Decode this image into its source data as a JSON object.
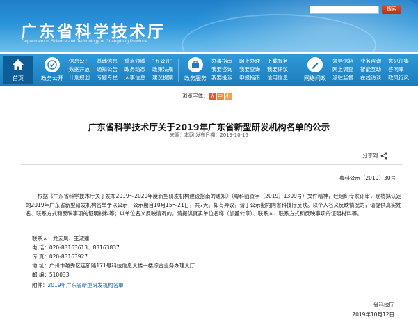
{
  "header": {
    "title": "广东省科学技术厅",
    "subtitle": "Department of Science and Technology of Guangdong Province",
    "search_button": "搜索",
    "search_placeholder": ""
  },
  "nav": {
    "home": "首页",
    "gov_public": {
      "label": "政务公开",
      "col1": [
        "信息公开",
        "数据开放",
        "计划规划"
      ],
      "col2": [
        "基础信息",
        "通知公告",
        "专题专栏"
      ],
      "col3": [
        "重点领域",
        "政务动态",
        "人事信息"
      ],
      "col4": [
        "\"五公开\"",
        "政策法规",
        "建议提案"
      ]
    },
    "gov_service": {
      "label": "政务服务",
      "col1": [
        "办事指南",
        "我要咨询",
        "我要投诉"
      ],
      "col2": [
        "网上办理",
        "我要查询",
        "申报指南"
      ],
      "col3": [
        "下载服务",
        "我要评议",
        "信用信息"
      ]
    },
    "interaction": {
      "label": "网络问政",
      "col1": [
        "领导信箱",
        "网上调查",
        "派驻监督"
      ],
      "col2": [
        "业务咨询",
        "智能互动",
        "在线访谈"
      ],
      "col3": [
        "意见征集",
        "答问库",
        "政风行风"
      ]
    }
  },
  "font_size": {
    "label": "浏览字体：",
    "big": "大",
    "mid": "中",
    "small": "小"
  },
  "article": {
    "title": "广东省科学技术厅关于2019年广东省新型研发机构名单的公示",
    "meta": "来源：本网   发布日期：2019-10-15",
    "share_label": "分享到",
    "doc_no": "粤科公示〔2019〕30号",
    "body": "根据《广东省科学技术厅关于发布2019～2020年度新型研发机构建设指南的通知》（粤科函资字〔2019〕1309号）文件精神，经组织专家评审，现将拟认定的2019年广东省新型研发机构名单予以公示，公示期自10月15～21日，共7天。如有异议，请于公示期内向省科技厅反映。以个人名义反映情况的，请提供真实姓名、联系方式和反映事项的证明材料等；以单位名义反映情况的，请提供真实单位名称（加盖公章）、联系人、联系方式和反映事项的证明材料等。",
    "contact": {
      "person": "联系人：龙云凤、王淑莲",
      "phone": "电   话：020-83163613、83163837",
      "fax": "传   真：020-83163927",
      "address": "地   址：广州市越秀区连新路171号科技信息大楼一楼综合业务办理大厅",
      "postcode": "邮   编：510033"
    },
    "attachment_label": "附件：",
    "attachment_link": "2019年广东省新型研发机构名单",
    "sign_org": "省科技厅",
    "sign_date": "2019年10月12日"
  },
  "colors": {
    "banner": "#2a93d9",
    "nav": "#1c7cbc",
    "home_block": "#0d5e98",
    "search_button": "#d4401f",
    "link": "#1a5fb4"
  },
  "icons": [
    "home-icon",
    "gov-public-icon",
    "gov-service-icon",
    "interaction-icon",
    "share-icon"
  ]
}
